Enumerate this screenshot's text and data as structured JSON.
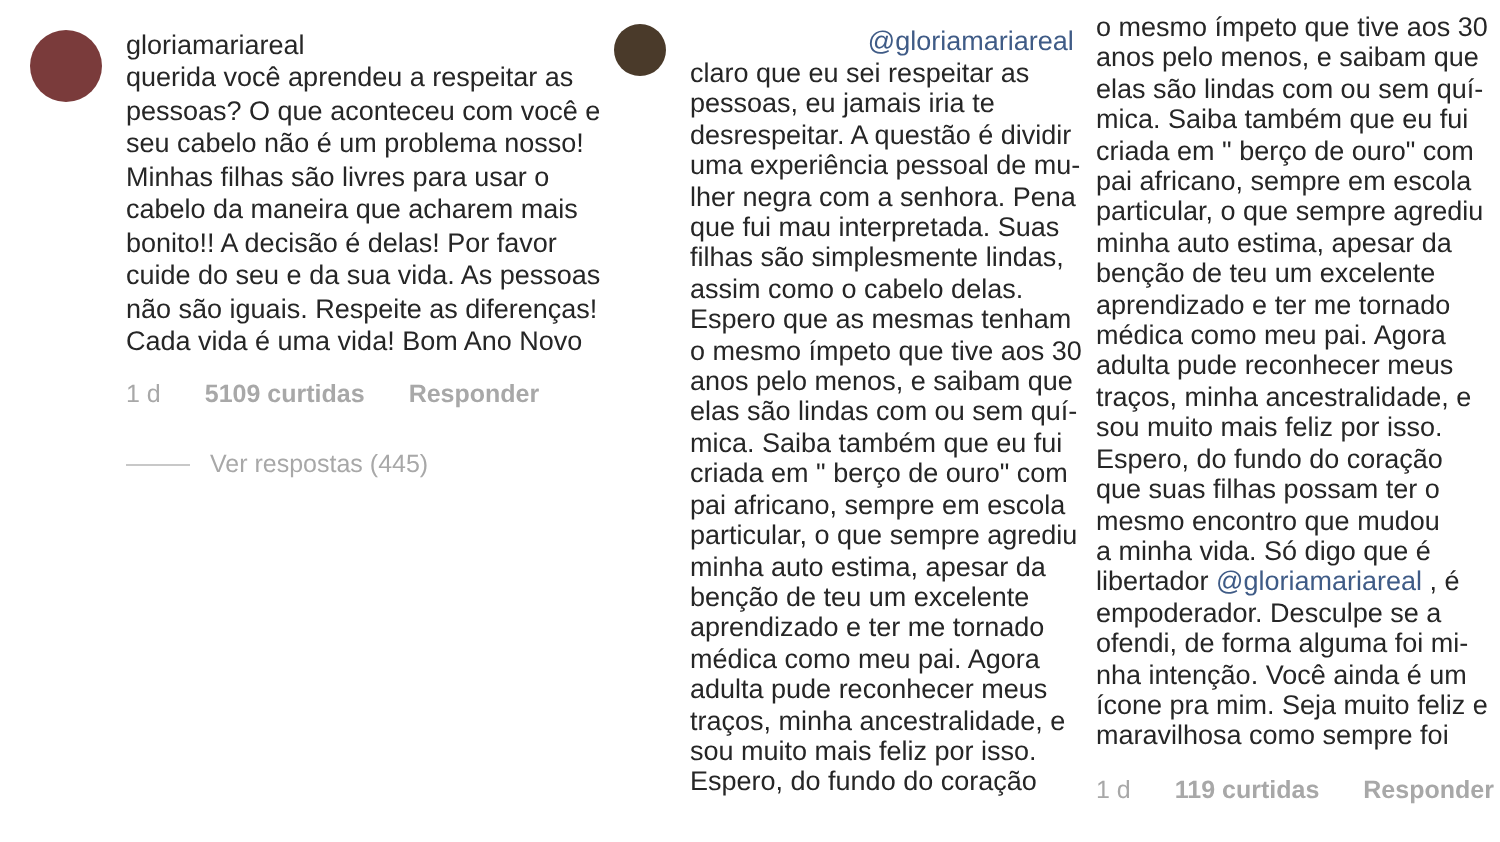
{
  "panels": [
    {
      "kind": "comment",
      "username": "gloriamariareal",
      "text": "querida você aprendeu a respeitar as\npessoas? O que aconteceu com você e\nseu cabelo não é um problema nosso!\nMinhas filhas são livres para usar o\ncabelo da maneira que acharem mais\nbonito!! A decisão é delas! Por favor\ncuide do seu e da sua vida. As pessoas\nnão são iguais. Respeite as diferenças!\nCada vida é uma vida! Bom Ano Novo",
      "time": "1 d",
      "likes": "5109 curtidas",
      "reply": "Responder",
      "view_replies": "Ver respostas (445)"
    },
    {
      "kind": "reply_top",
      "mention": "@gloriamariareal",
      "text": "claro que eu sei respeitar as\npessoas, eu jamais iria te\ndesrespeitar. A questão é dividir\numa experiência pessoal de mu-\nlher negra com a senhora. Pena\nque fui mau interpretada. Suas\nfilhas são simplesmente lindas,\nassim como o cabelo delas.\nEspero que as mesmas tenham\no mesmo ímpeto que tive aos 30\nanos pelo menos, e saibam que\nelas são lindas com ou sem quí-\nmica. Saiba também que eu fui\ncriada em \" berço de ouro\" com\npai africano, sempre em escola\nparticular, o que sempre agrediu\nminha auto estima, apesar da\nbenção de teu um excelente\naprendizado e ter me tornado\nmédica como meu pai. Agora\nadulta pude reconhecer meus\ntraços, minha ancestralidade, e\nsou muito mais feliz por isso.\nEspero, do fundo do coração"
    },
    {
      "kind": "reply_bottom",
      "segments": [
        {
          "kind": "text",
          "text": "o mesmo ímpeto que tive aos 30\nanos pelo menos, e saibam que\nelas são lindas com ou sem quí-\nmica. Saiba também que eu fui\ncriada em \" berço de ouro\" com\npai africano, sempre em escola\nparticular, o que sempre agrediu\nminha auto estima, apesar da\nbenção de teu um excelente\naprendizado e ter me tornado\nmédica como meu pai. Agora\nadulta pude reconhecer meus\ntraços, minha ancestralidade, e\nsou muito mais feliz por isso.\nEspero, do fundo do coração\nque suas filhas possam ter o\nmesmo encontro que mudou\na minha vida. Só digo que é\nlibertador "
        },
        {
          "kind": "mention",
          "text": "@gloriamariareal"
        },
        {
          "kind": "text",
          "text": " , é\nempoderador. Desculpe se a\nofendi, de forma alguma foi mi-\nnha intenção. Você ainda é um\nícone pra mim. Seja muito feliz e\nmaravilhosa como sempre foi"
        }
      ],
      "time": "1 d",
      "likes": "119 curtidas",
      "reply": "Responder"
    }
  ]
}
